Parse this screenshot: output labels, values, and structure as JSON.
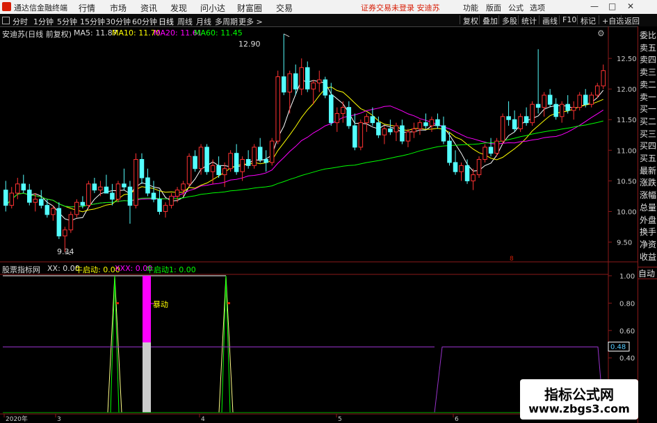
{
  "app": {
    "title": "通达信金融终端",
    "menus": [
      "行情",
      "市场",
      "资讯",
      "发现",
      "问小达",
      "财富圈",
      "交易"
    ],
    "notice": "证券交易未登录  安迪苏",
    "right_menus": [
      "功能",
      "版面",
      "公式",
      "选项"
    ],
    "window_buttons": [
      "—",
      "□",
      "✕"
    ]
  },
  "toolbar": {
    "periods": [
      "分时",
      "1分钟",
      "5分钟",
      "15分钟",
      "30分钟",
      "60分钟",
      "日线",
      "周线",
      "月线",
      "多周期",
      "更多 >"
    ],
    "active_period": "日线",
    "right_buttons": [
      "复权",
      "叠加",
      "多股",
      "统计",
      "画线",
      "F10",
      "标记",
      "+自选",
      "返回"
    ]
  },
  "main_chart": {
    "header": {
      "stock": "安迪苏(日线 前复权)",
      "ma5": "MA5: 11.87",
      "ma10": "MA10: 11.70",
      "ma20": "MA20: 11.61",
      "ma60": "MA60: 11.45"
    },
    "high_label": "12.90",
    "low_label": "9.34",
    "price_ticks": [
      "12.50",
      "12.00",
      "11.50",
      "11.00",
      "10.50",
      "10.00",
      "9.50"
    ],
    "marker": "8"
  },
  "sub_chart": {
    "header": {
      "name": "股票指标网",
      "xx": "XX: 0.00",
      "niu": "牛启动: 0.00",
      "xxx": "XXX: 0.00",
      "niu1": "牛启动1: 0.00"
    },
    "label_baodong": "暴动",
    "ticks": [
      "1.00",
      "0.80",
      "0.60",
      "0.40"
    ],
    "current_value": "0.48"
  },
  "time_axis": [
    "2020年",
    "3",
    "4",
    "5",
    "6"
  ],
  "sidebar": [
    "委比",
    "卖五",
    "卖四",
    "卖三",
    "卖二",
    "卖一",
    "买一",
    "买二",
    "买三",
    "买四",
    "买五",
    "最新",
    "涨跌",
    "涨幅",
    "总量",
    "外盘",
    "换手",
    "净资",
    "收益"
  ],
  "auto_button": "自动",
  "watermark": {
    "title": "指标公式网",
    "url": "www.zbgs3.com"
  },
  "colors": {
    "up": "#ff3232",
    "down": "#54ffff",
    "ma5": "#ffffff",
    "ma10": "#ffff00",
    "ma20": "#ff00ff",
    "ma60": "#00ff00",
    "purple": "#9933cc",
    "grid": "#8b1a1a"
  },
  "chart_data": {
    "type": "candlestick",
    "ylim": [
      9.2,
      13.0
    ],
    "candles": [
      [
        10.35,
        10.5,
        10.0,
        10.1
      ],
      [
        10.1,
        10.4,
        10.05,
        10.3
      ],
      [
        10.3,
        10.55,
        10.2,
        10.45
      ],
      [
        10.45,
        10.6,
        10.3,
        10.35
      ],
      [
        10.35,
        10.45,
        10.1,
        10.15
      ],
      [
        10.15,
        10.3,
        10.0,
        10.2
      ],
      [
        10.2,
        10.35,
        10.05,
        10.1
      ],
      [
        10.1,
        10.2,
        9.9,
        9.95
      ],
      [
        9.95,
        10.1,
        9.85,
        10.05
      ],
      [
        10.05,
        10.15,
        9.55,
        9.6
      ],
      [
        9.6,
        9.75,
        9.34,
        9.7
      ],
      [
        9.7,
        10.0,
        9.65,
        9.95
      ],
      [
        9.95,
        10.2,
        9.9,
        10.15
      ],
      [
        10.15,
        10.25,
        10.05,
        10.1
      ],
      [
        10.1,
        10.5,
        10.05,
        10.45
      ],
      [
        10.45,
        10.55,
        10.3,
        10.35
      ],
      [
        10.35,
        10.5,
        10.25,
        10.4
      ],
      [
        10.4,
        10.6,
        10.3,
        10.3
      ],
      [
        10.3,
        10.45,
        10.1,
        10.2
      ],
      [
        10.2,
        10.5,
        10.15,
        10.45
      ],
      [
        10.45,
        10.7,
        10.35,
        10.4
      ],
      [
        10.4,
        10.5,
        9.8,
        10.1
      ],
      [
        10.1,
        10.95,
        10.05,
        10.85
      ],
      [
        10.85,
        10.95,
        10.45,
        10.55
      ],
      [
        10.55,
        10.7,
        10.25,
        10.3
      ],
      [
        10.3,
        10.5,
        10.15,
        10.2
      ],
      [
        10.2,
        10.35,
        9.95,
        10.0
      ],
      [
        10.0,
        10.15,
        9.9,
        10.1
      ],
      [
        10.1,
        10.3,
        10.05,
        10.25
      ],
      [
        10.25,
        10.4,
        10.15,
        10.35
      ],
      [
        10.35,
        10.5,
        10.25,
        10.45
      ],
      [
        10.45,
        10.95,
        10.4,
        10.9
      ],
      [
        10.9,
        11.0,
        10.65,
        10.7
      ],
      [
        10.7,
        11.1,
        10.6,
        11.05
      ],
      [
        11.05,
        11.1,
        10.6,
        10.65
      ],
      [
        10.65,
        10.85,
        10.45,
        10.75
      ],
      [
        10.75,
        10.9,
        10.55,
        10.6
      ],
      [
        10.6,
        10.8,
        10.4,
        10.7
      ],
      [
        10.7,
        11.0,
        10.65,
        10.95
      ],
      [
        10.95,
        11.1,
        10.6,
        10.65
      ],
      [
        10.65,
        10.9,
        10.5,
        10.85
      ],
      [
        10.85,
        11.0,
        10.7,
        10.75
      ],
      [
        10.75,
        11.1,
        10.7,
        11.05
      ],
      [
        11.05,
        11.2,
        10.8,
        10.85
      ],
      [
        10.85,
        11.0,
        10.65,
        10.8
      ],
      [
        10.8,
        11.2,
        10.75,
        11.15
      ],
      [
        11.15,
        12.3,
        11.1,
        12.2
      ],
      [
        12.2,
        12.9,
        11.9,
        11.95
      ],
      [
        11.95,
        12.3,
        11.6,
        12.25
      ],
      [
        12.25,
        12.4,
        11.9,
        12.0
      ],
      [
        12.0,
        12.5,
        11.9,
        12.35
      ],
      [
        12.35,
        12.45,
        11.95,
        12.0
      ],
      [
        12.0,
        12.15,
        11.75,
        12.1
      ],
      [
        12.1,
        12.3,
        11.95,
        12.15
      ],
      [
        12.15,
        12.2,
        11.85,
        11.9
      ],
      [
        11.9,
        12.1,
        11.4,
        11.45
      ],
      [
        11.45,
        11.7,
        11.3,
        11.6
      ],
      [
        11.6,
        11.8,
        11.45,
        11.7
      ],
      [
        11.7,
        11.8,
        11.35,
        11.4
      ],
      [
        11.4,
        11.6,
        11.0,
        11.05
      ],
      [
        11.05,
        11.5,
        11.0,
        11.45
      ],
      [
        11.45,
        11.6,
        11.3,
        11.55
      ],
      [
        11.55,
        11.7,
        11.4,
        11.45
      ],
      [
        11.45,
        11.55,
        11.2,
        11.25
      ],
      [
        11.25,
        11.4,
        11.1,
        11.35
      ],
      [
        11.35,
        11.5,
        11.25,
        11.3
      ],
      [
        11.3,
        11.45,
        11.15,
        11.4
      ],
      [
        11.4,
        11.5,
        11.1,
        11.15
      ],
      [
        11.15,
        11.35,
        11.05,
        11.3
      ],
      [
        11.3,
        11.45,
        11.2,
        11.35
      ],
      [
        11.35,
        11.5,
        11.25,
        11.45
      ],
      [
        11.45,
        11.6,
        11.35,
        11.4
      ],
      [
        11.4,
        11.55,
        11.3,
        11.5
      ],
      [
        11.5,
        11.6,
        11.35,
        11.4
      ],
      [
        11.4,
        11.55,
        11.1,
        11.15
      ],
      [
        11.15,
        11.3,
        10.75,
        10.8
      ],
      [
        10.8,
        11.0,
        10.6,
        10.65
      ],
      [
        10.65,
        10.8,
        10.5,
        10.75
      ],
      [
        10.75,
        10.85,
        10.45,
        10.5
      ],
      [
        10.5,
        10.7,
        10.35,
        10.6
      ],
      [
        10.6,
        10.9,
        10.55,
        10.85
      ],
      [
        10.85,
        11.1,
        10.8,
        11.05
      ],
      [
        11.05,
        11.2,
        10.9,
        10.95
      ],
      [
        10.95,
        11.2,
        10.9,
        11.15
      ],
      [
        11.15,
        11.6,
        11.1,
        11.55
      ],
      [
        11.55,
        11.8,
        11.4,
        11.5
      ],
      [
        11.5,
        11.65,
        11.3,
        11.35
      ],
      [
        11.35,
        11.6,
        11.3,
        11.55
      ],
      [
        11.55,
        11.7,
        11.4,
        11.45
      ],
      [
        11.45,
        11.8,
        11.4,
        11.75
      ],
      [
        11.75,
        12.65,
        11.6,
        11.7
      ],
      [
        11.7,
        11.95,
        11.55,
        11.9
      ],
      [
        11.9,
        12.0,
        11.7,
        11.75
      ],
      [
        11.75,
        11.85,
        11.5,
        11.55
      ],
      [
        11.55,
        11.8,
        11.45,
        11.75
      ],
      [
        11.75,
        11.9,
        11.6,
        11.65
      ],
      [
        11.65,
        11.8,
        11.5,
        11.7
      ],
      [
        11.7,
        11.95,
        11.65,
        11.9
      ],
      [
        11.9,
        12.0,
        11.7,
        11.75
      ],
      [
        11.75,
        11.95,
        11.7,
        11.9
      ],
      [
        11.9,
        12.1,
        11.85,
        12.05
      ],
      [
        12.05,
        12.4,
        12.0,
        12.3
      ]
    ],
    "sub_values_purple": "0.48"
  }
}
